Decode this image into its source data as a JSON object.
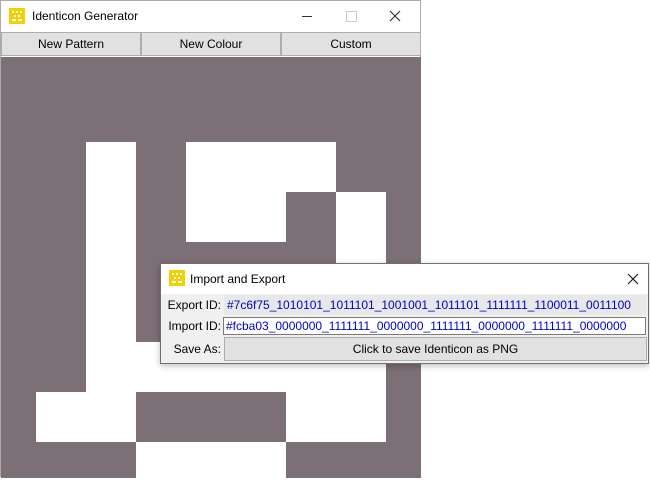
{
  "main_window": {
    "title": "Identicon Generator",
    "toolbar": {
      "new_pattern_label": "New Pattern",
      "new_colour_label": "New Colour",
      "custom_label": "Custom"
    },
    "canvas": {
      "background_color": "#7c6f75",
      "foreground_color": "#ffffff",
      "rows": [
        "0000000",
        "0101110",
        "0101101",
        "0100001",
        "0101101",
        "0111111",
        "1100011",
        "0011100"
      ]
    }
  },
  "dialog": {
    "title": "Import and Export",
    "export_label": "Export ID:",
    "export_value": "#7c6f75_1010101_1011101_1001001_1011101_1111111_1100011_0011100",
    "import_label": "Import ID:",
    "import_value": "#fcba03_0000000_1111111_0000000_1111111_0000000_1111111_0000000",
    "save_as_label": "Save As:",
    "save_button_label": "Click to save Identicon as PNG"
  },
  "icons": {
    "app": "identicon-app-icon",
    "minimize": "minimize-icon",
    "maximize": "maximize-icon",
    "close": "close-icon"
  }
}
